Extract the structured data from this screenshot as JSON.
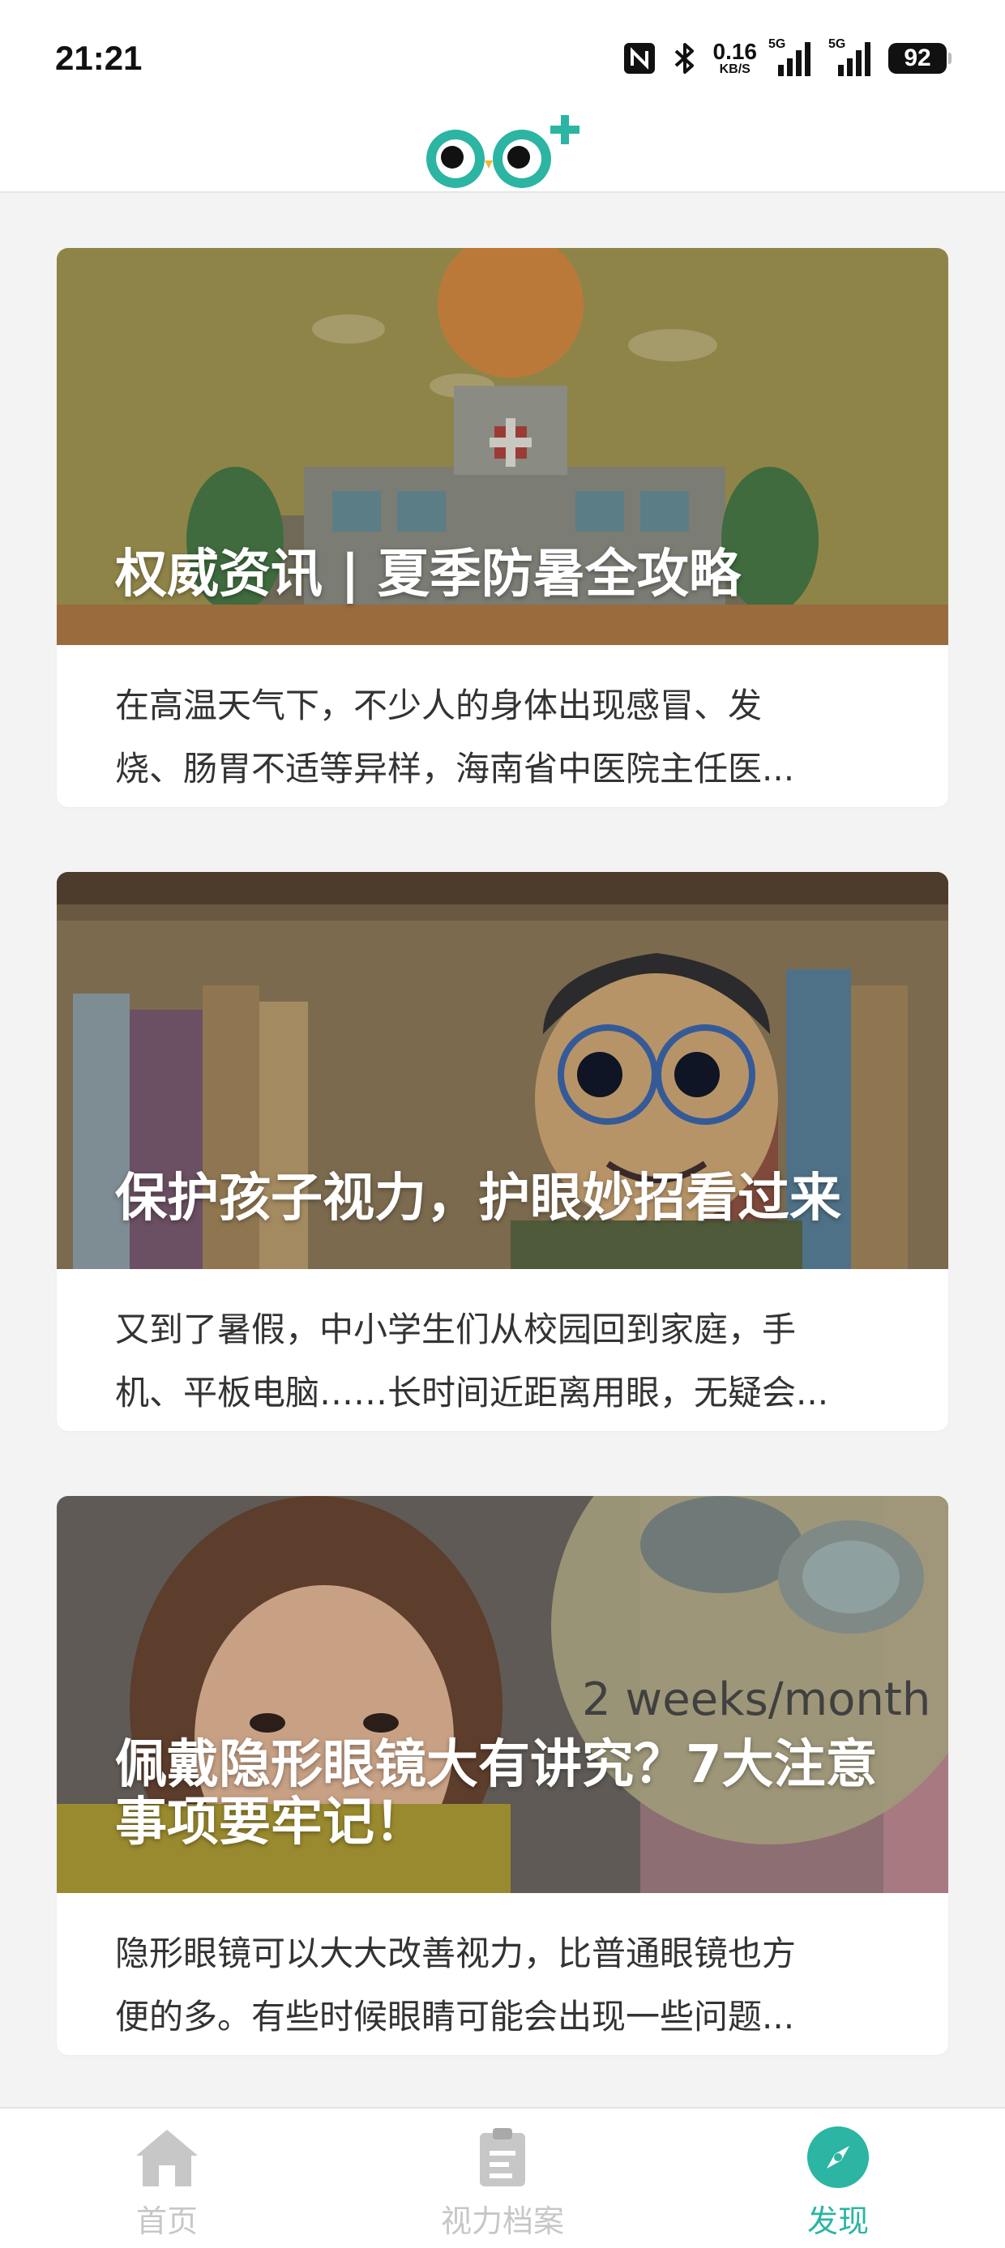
{
  "status_bar": {
    "time": "21:21",
    "net_speed_value": "0.16",
    "net_speed_unit": "KB/S",
    "signal1_label": "5G",
    "signal2_label": "5G",
    "battery": "92"
  },
  "header": {
    "logo_icon": "owl-eyes-plus-logo"
  },
  "articles": [
    {
      "title": "权威资讯 | 夏季防暑全攻略",
      "summary_line1": "在高温天气下，不少人的身体出现感冒、发",
      "summary_line2": "烧、肠胃不适等异样，海南省中医院主任医...",
      "image": "hospital-under-hot-sun-illustration"
    },
    {
      "title": "保护孩子视力，护眼妙招看过来",
      "summary_line1": "又到了暑假，中小学生们从校园回到家庭，手",
      "summary_line2": "机、平板电脑……长时间近距离用眼，无疑会...",
      "image": "child-with-glasses-and-books-illustration"
    },
    {
      "title": "佩戴隐形眼镜大有讲究？7大注意事项要牢记！",
      "summary_line1": "隐形眼镜可以大大改善视力，比普通眼镜也方",
      "summary_line2": "便的多。有些时候眼睛可能会出现一些问题...",
      "image": "woman-and-contact-lens-case-illustration",
      "image_text": "2 weeks/month"
    }
  ],
  "bottom_nav": {
    "items": [
      {
        "label": "首页",
        "icon": "home-icon",
        "active": false
      },
      {
        "label": "视力档案",
        "icon": "clipboard-icon",
        "active": false
      },
      {
        "label": "发现",
        "icon": "compass-icon",
        "active": true
      }
    ]
  },
  "colors": {
    "accent": "#2bb5a2",
    "inactive": "#c7c7c7",
    "background": "#f3f3f3"
  }
}
